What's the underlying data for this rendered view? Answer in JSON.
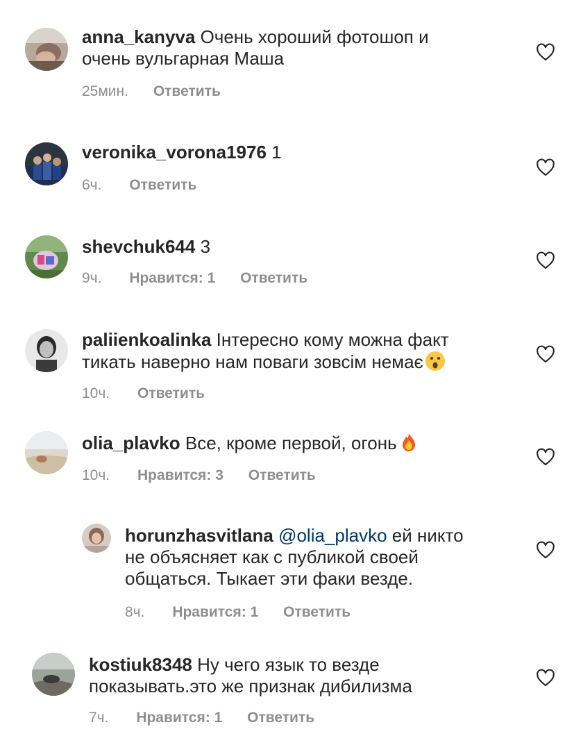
{
  "comments": [
    {
      "username": "anna_kanyva",
      "text": "Очень хороший фотошоп и\nочень вульгарная Маша",
      "time": "25мин.",
      "likes": "",
      "reply": "Ответить"
    },
    {
      "username": "veronika_vorona1976",
      "text": "1",
      "time": "6ч.",
      "likes": "",
      "reply": "Ответить"
    },
    {
      "username": "shevchuk644",
      "text": "3",
      "time": "9ч.",
      "likes": "Нравится: 1",
      "reply": "Ответить"
    },
    {
      "username": "paliienkoalinka",
      "text": "Інтересно кому можна факт\nтикать наверно нам поваги зовсім немає",
      "emoji": "astonished-face",
      "time": "10ч.",
      "likes": "",
      "reply": "Ответить"
    },
    {
      "username": "olia_plavko",
      "text": "Все, кроме первой, огонь",
      "emoji": "fire",
      "time": "10ч.",
      "likes": "Нравится: 3",
      "reply": "Ответить"
    },
    {
      "username": "horunzhasvitlana",
      "mention": "@olia_plavko",
      "text": "ей никто\nне объясняет как с публикой своей\nобщаться. Тыкает эти факи везде.",
      "time": "8ч.",
      "likes": "Нравится: 1",
      "reply": "Ответить"
    },
    {
      "username": "kostiuk8348",
      "text": "Ну чего язык то везде\nпоказывать.это же признак дибилизма",
      "time": "7ч.",
      "likes": "Нравится: 1",
      "reply": "Ответить"
    }
  ],
  "icons": {
    "like": "heart-outline-icon"
  },
  "colors": {
    "text": "#262626",
    "meta": "#8e8e8e",
    "mention": "#00376b"
  }
}
